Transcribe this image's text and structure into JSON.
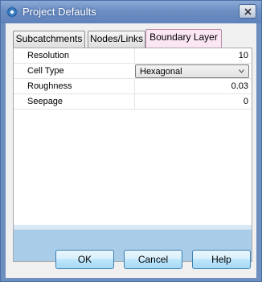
{
  "window": {
    "title": "Project Defaults",
    "app_icon": "gear-icon",
    "close_icon": "close-icon"
  },
  "tabs": [
    {
      "label": "Subcatchments",
      "active": false
    },
    {
      "label": "Nodes/Links",
      "active": false
    },
    {
      "label": "Boundary Layer",
      "active": true
    }
  ],
  "properties": [
    {
      "label": "Resolution",
      "value": "10"
    },
    {
      "label": "Cell Type",
      "value": "Hexagonal"
    },
    {
      "label": "Roughness",
      "value": "0.03"
    },
    {
      "label": "Seepage",
      "value": "0"
    }
  ],
  "buttons": {
    "ok": "OK",
    "cancel": "Cancel",
    "help": "Help"
  },
  "colors": {
    "active_tab": "#fbe6f3",
    "description_area": "#a9cde8",
    "button_border": "#3c7fb1"
  }
}
